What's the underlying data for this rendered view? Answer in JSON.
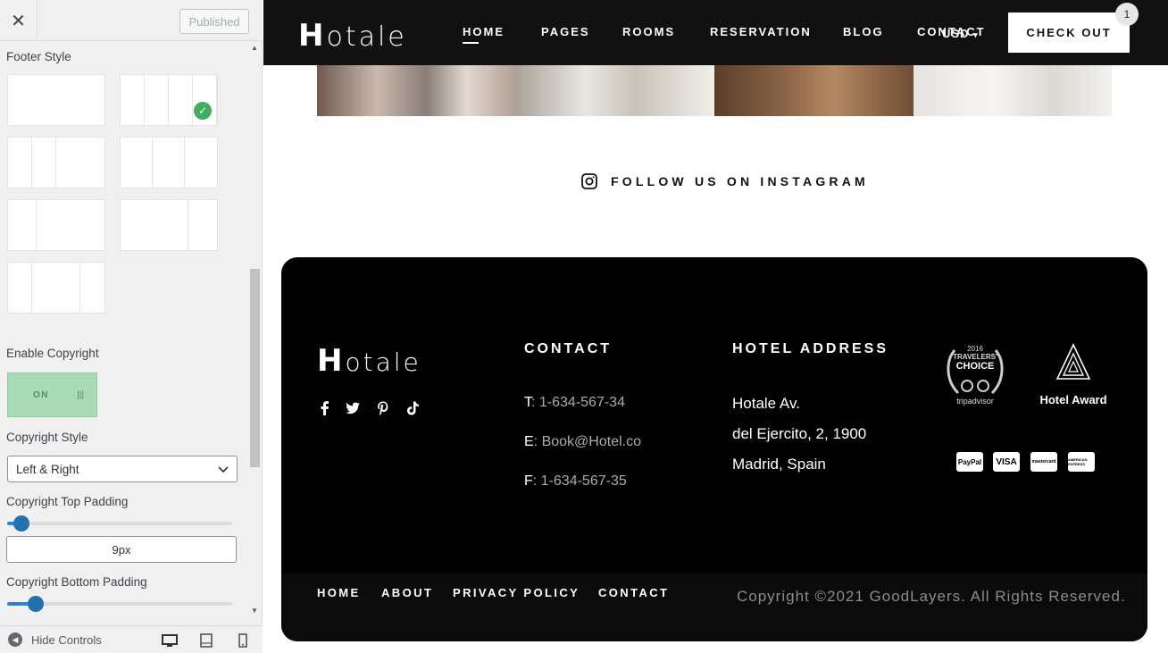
{
  "customizer": {
    "close_label": "✕",
    "publish_label": "Published",
    "sections": {
      "footer_style": "Footer Style",
      "enable_copyright": "Enable Copyright",
      "toggle_label": "ON",
      "copyright_style": "Copyright Style",
      "copyright_style_value": "Left & Right",
      "copyright_top_padding": "Copyright Top Padding",
      "copyright_top_padding_value": "9px",
      "copyright_top_padding_level": 0.03,
      "copyright_bottom_padding": "Copyright Bottom Padding",
      "copyright_bottom_padding_level": 0.1
    },
    "footer_layouts_selected": 1,
    "footer": {
      "hide_controls": "Hide Controls",
      "device_icons": [
        "desktop-icon",
        "tablet-icon",
        "mobile-icon"
      ]
    }
  },
  "site": {
    "logo": {
      "initial": "H",
      "rest": "otale"
    },
    "nav": [
      "HOME",
      "PAGES",
      "ROOMS",
      "RESERVATION",
      "BLOG",
      "CONTACT"
    ],
    "active_nav": "HOME",
    "currency": "USD",
    "checkout_label": "CHECK OUT",
    "cart_count": "1",
    "instagram_cta": "FOLLOW US ON INSTAGRAM",
    "footer": {
      "contact_title": "CONTACT",
      "contact": [
        {
          "key": "T",
          "value": "1-634-567-34"
        },
        {
          "key": "E",
          "value": "Book@Hotel.co"
        },
        {
          "key": "F",
          "value": "1-634-567-35"
        }
      ],
      "address_title": "HOTEL ADDRESS",
      "address": [
        "Hotale Av.",
        "del Ejercito, 2, 1900",
        "Madrid, Spain"
      ],
      "award_tripadvisor": {
        "year": "2016",
        "line1": "TRAVELERS'",
        "line2": "CHOICE",
        "brand": "tripadvisor"
      },
      "award_hotel": "Hotel Award",
      "payments": [
        "PayPal",
        "VISA",
        "mastercard",
        "AMERICAN EXPRESS"
      ],
      "social": [
        "facebook-icon",
        "twitter-icon",
        "pinterest-icon",
        "tiktok-icon"
      ],
      "copy_links": [
        "HOME",
        "ABOUT",
        "PRIVACY POLICY",
        "CONTACT"
      ],
      "copyright": "Copyright ©2021 GoodLayers. All Rights Reserved."
    }
  },
  "colors": {
    "accent": "#2271b1",
    "toggle_on": "#a8dbb5",
    "check": "#3fae5f",
    "footer_bg": "#000000"
  }
}
